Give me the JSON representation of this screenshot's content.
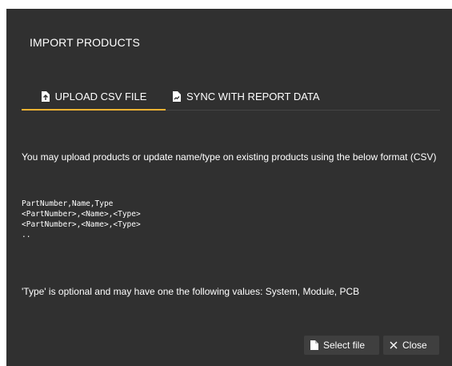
{
  "dialog": {
    "title": "IMPORT PRODUCTS",
    "tabs": [
      {
        "label": "UPLOAD CSV FILE",
        "icon": "file-upload-icon",
        "active": true
      },
      {
        "label": "SYNC WITH REPORT DATA",
        "icon": "report-chart-icon",
        "active": false
      }
    ],
    "description": "You may upload products or update name/type on existing products using the below format (CSV)",
    "code_lines": [
      "PartNumber,Name,Type",
      "<PartNumber>,<Name>,<Type>",
      "<PartNumber>,<Name>,<Type>",
      ".."
    ],
    "note": "'Type' is optional and may have one the following values: System, Module, PCB",
    "buttons": {
      "select_file": "Select file",
      "close": "Close"
    },
    "colors": {
      "background": "#303030",
      "accent": "#f2b233",
      "button": "#3f3f3f"
    }
  }
}
